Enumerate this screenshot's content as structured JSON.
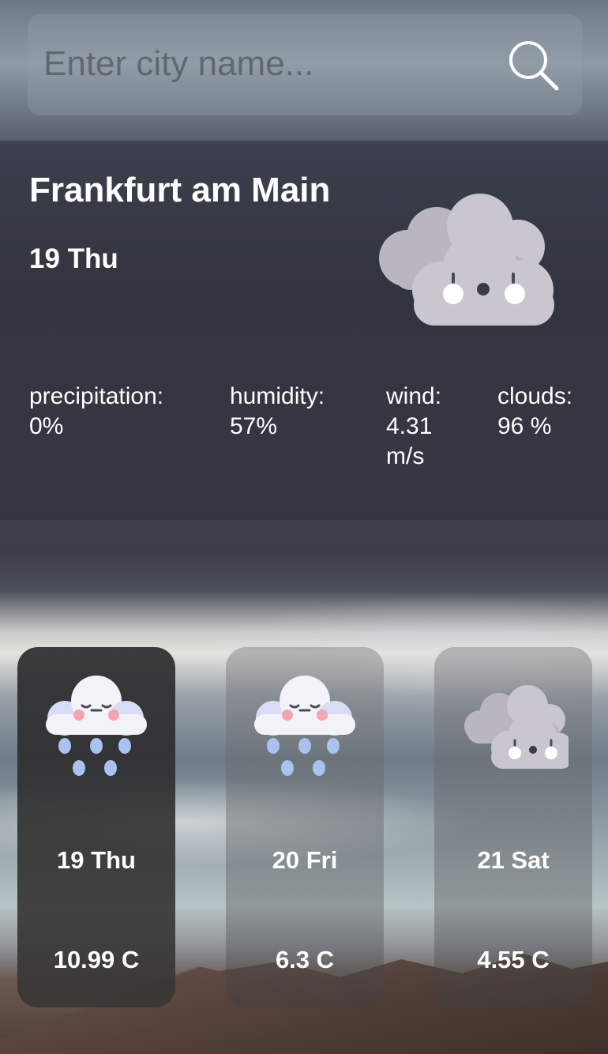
{
  "search": {
    "placeholder": "Enter city name...",
    "value": "",
    "icon": "search-icon"
  },
  "current": {
    "city": "Frankfurt am Main",
    "date": "19 Thu",
    "icon": "cloudy-icon",
    "stats": [
      {
        "label": "precipitation:",
        "value": "0%"
      },
      {
        "label": "humidity:",
        "value": "57%"
      },
      {
        "label": "wind:",
        "value": "4.31 m/s"
      },
      {
        "label": "clouds:",
        "value": "96 %"
      }
    ]
  },
  "forecast": [
    {
      "day": "19 Thu",
      "temp": "10.99 C",
      "icon": "rain-cloud-icon",
      "active": true
    },
    {
      "day": "20 Fri",
      "temp": "6.3 C",
      "icon": "rain-cloud-icon",
      "active": false
    },
    {
      "day": "21 Sat",
      "temp": "4.55 C",
      "icon": "cloudy-icon",
      "active": false
    }
  ],
  "colors": {
    "cloud_light": "#f2f2f8",
    "cloud_grey": "#b9b6c2",
    "raindrop": "#a9c3ef",
    "blush": "#f5a3b3"
  }
}
